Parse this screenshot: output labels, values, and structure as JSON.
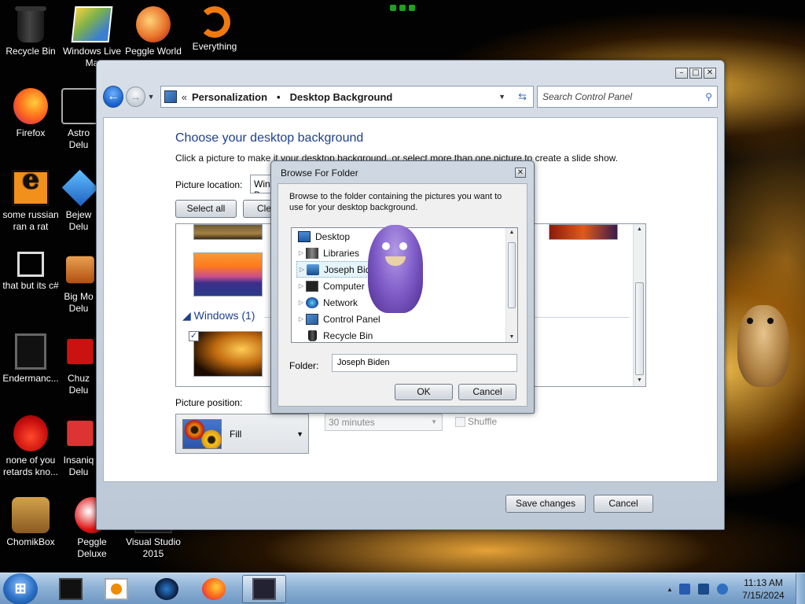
{
  "desktop": {
    "icons": [
      {
        "label": "Recycle Bin"
      },
      {
        "label": "Windows Live Ma"
      },
      {
        "label": "Peggle World"
      },
      {
        "label": "Everything"
      },
      {
        "label": "Firefox"
      },
      {
        "label": "Astro Delu"
      },
      {
        "label": "some russian ran a rat"
      },
      {
        "label": "Bejew Delu"
      },
      {
        "label": "that but its c#"
      },
      {
        "label": "Big Mo Delu"
      },
      {
        "label": "Endermanc..."
      },
      {
        "label": "Chuz Delu"
      },
      {
        "label": "none of you retards kno..."
      },
      {
        "label": "Insaniq Delu"
      },
      {
        "label": "ChomikBox"
      },
      {
        "label": "Peggle Deluxe"
      },
      {
        "label": "Visual Studio 2015"
      }
    ]
  },
  "window": {
    "nav": {
      "back_icon": "back-arrow-icon",
      "forward_icon": "forward-arrow-icon",
      "crumb_prefix": "«",
      "breadcrumbs": [
        "Personalization",
        "Desktop Background"
      ],
      "search_placeholder": "Search Control Panel"
    },
    "title": "Choose your desktop background",
    "description": "Click a picture to make it your desktop background, or select more than one picture to create a slide show.",
    "picture_location_label": "Picture location:",
    "picture_location_value": "Windows Desktop Backgrounds",
    "select_all": "Select all",
    "clear_all": "Clear all",
    "group_title": "Windows (1)",
    "picture_position_label": "Picture position:",
    "picture_position_value": "Fill",
    "interval_value": "30 minutes",
    "shuffle_label": "Shuffle",
    "save_changes": "Save changes",
    "cancel": "Cancel"
  },
  "dialog": {
    "title": "Browse For Folder",
    "message": "Browse to the folder containing the pictures you want to use for your desktop background.",
    "tree": [
      {
        "label": "Desktop",
        "icon": "desktop-icon",
        "expandable": false
      },
      {
        "label": "Libraries",
        "icon": "libraries-icon",
        "expandable": true
      },
      {
        "label": "Joseph Biden",
        "icon": "user-folder-icon",
        "expandable": true,
        "selected": true
      },
      {
        "label": "Computer",
        "icon": "computer-icon",
        "expandable": true
      },
      {
        "label": "Network",
        "icon": "network-icon",
        "expandable": true
      },
      {
        "label": "Control Panel",
        "icon": "control-panel-icon",
        "expandable": true
      },
      {
        "label": "Recycle Bin",
        "icon": "recycle-bin-icon",
        "expandable": false
      }
    ],
    "folder_label": "Folder:",
    "folder_value": "Joseph Biden",
    "ok": "OK",
    "cancel": "Cancel"
  },
  "taskbar": {
    "time": "11:13 AM",
    "date": "7/15/2024"
  }
}
